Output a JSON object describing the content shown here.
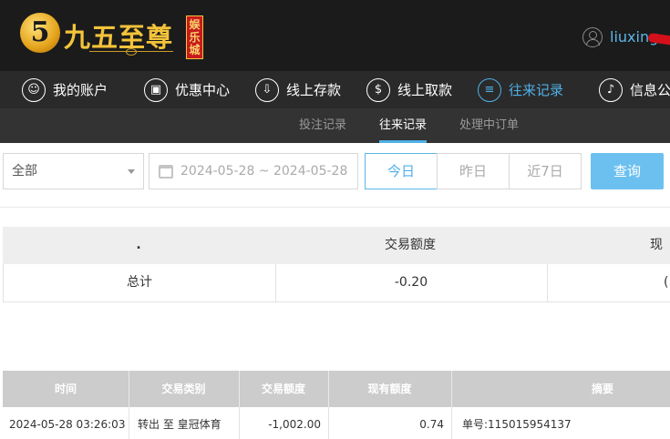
{
  "header": {
    "logo_mark": "5",
    "logo_text": "九五至尊",
    "logo_badge": "娱乐城",
    "username": "liuxing"
  },
  "main_nav": [
    {
      "label": "我的账户",
      "icon": "user-icon",
      "glyph": "☺"
    },
    {
      "label": "优惠中心",
      "icon": "gift-icon",
      "glyph": "▣"
    },
    {
      "label": "线上存款",
      "icon": "deposit-icon",
      "glyph": "⇩"
    },
    {
      "label": "线上取款",
      "icon": "withdraw-icon",
      "glyph": "$"
    },
    {
      "label": "往来记录",
      "icon": "records-icon",
      "glyph": "≡",
      "active": true
    },
    {
      "label": "信息公",
      "icon": "bell-icon",
      "glyph": "♪"
    }
  ],
  "sub_nav": [
    {
      "label": "投注记录"
    },
    {
      "label": "往来记录",
      "active": true
    },
    {
      "label": "处理中订单"
    }
  ],
  "filters": {
    "type_select": "全部",
    "date_range": "2024-05-28 ~ 2024-05-28",
    "quick": [
      "今日",
      "昨日",
      "近7日"
    ],
    "active_quick": "今日",
    "query_label": "查询"
  },
  "summary": {
    "headers": [
      ".",
      "交易额度",
      "现"
    ],
    "row": [
      "总计",
      "-0.20",
      "("
    ]
  },
  "details": {
    "headers": [
      "时间",
      "交易类别",
      "交易额度",
      "现有额度",
      "摘要"
    ],
    "rows": [
      [
        "2024-05-28 03:26:03",
        "转出 至 皇冠体育",
        "-1,002.00",
        "0.74",
        "单号:115015954137"
      ]
    ]
  },
  "colors": {
    "accent": "#4fb0e6",
    "gold": "#f3c33a",
    "header_bg": "#1b1b1b",
    "query_button": "#6cc0f0"
  }
}
